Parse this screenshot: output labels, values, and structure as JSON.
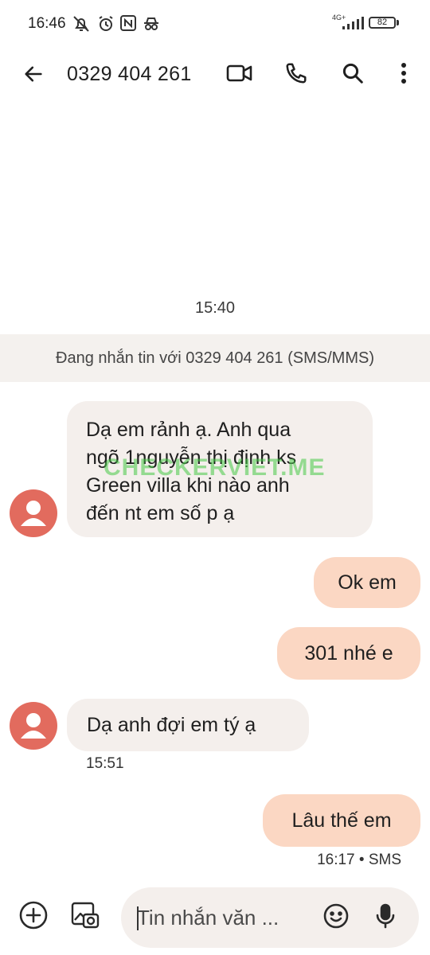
{
  "status_bar": {
    "time": "16:46",
    "network": "4G+",
    "battery": "82"
  },
  "header": {
    "title": "0329 404 261"
  },
  "conversation": {
    "divider_time": "15:40",
    "info_banner": "Đang nhắn tin với 0329 404 261 (SMS/MMS)",
    "messages": [
      {
        "direction": "incoming",
        "lines": [
          "Dạ em rảnh ạ. Anh qua",
          "ngõ 1nguyễn thị định ks",
          "Green villa khi nào anh",
          "đến nt em số p ạ"
        ]
      },
      {
        "direction": "outgoing",
        "text": "Ok em"
      },
      {
        "direction": "outgoing",
        "text": "301 nhé e"
      },
      {
        "direction": "incoming",
        "text": "Dạ anh đợi em tý ạ",
        "meta": "15:51"
      },
      {
        "direction": "outgoing",
        "text": "Lâu thế em",
        "meta": "16:17 • SMS"
      }
    ]
  },
  "watermark": "CHECKERVIET.ME",
  "compose": {
    "placeholder": "Tin nhắn văn ..."
  },
  "colors": {
    "incoming_bubble": "#f4efec",
    "outgoing_bubble": "#fbd7c3",
    "avatar": "#e26b5e",
    "banner": "#f4f1ee"
  },
  "icons": [
    "back-arrow-icon",
    "video-call-icon",
    "phone-icon",
    "search-icon",
    "more-vert-icon",
    "add-icon",
    "gallery-icon",
    "emoji-icon",
    "mic-icon"
  ]
}
